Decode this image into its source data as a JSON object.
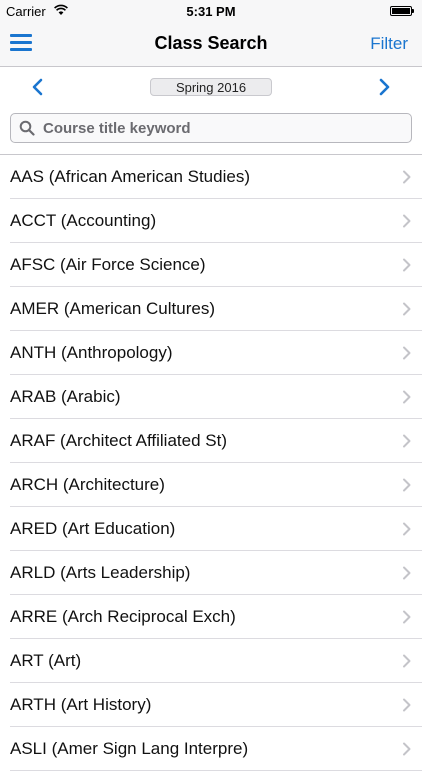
{
  "status_bar": {
    "carrier": "Carrier",
    "time": "5:31 PM",
    "battery_level": 1.0
  },
  "nav": {
    "title": "Class Search",
    "filter_label": "Filter",
    "menu_icon": "hamburger-icon"
  },
  "term": {
    "selected": "Spring 2016",
    "prev_icon": "chevron-left-icon",
    "next_icon": "chevron-right-icon"
  },
  "search": {
    "placeholder": "Course title keyword",
    "value": ""
  },
  "colors": {
    "accent": "#1a75cf",
    "separator": "#dcdbe0",
    "bar_background": "#f7f7f8"
  },
  "departments": [
    "AAS (African American Studies)",
    "ACCT (Accounting)",
    "AFSC (Air Force Science)",
    "AMER (American Cultures)",
    "ANTH (Anthropology)",
    "ARAB (Arabic)",
    "ARAF (Architect Affiliated St)",
    "ARCH (Architecture)",
    "ARED (Art Education)",
    "ARLD (Arts Leadership)",
    "ARRE (Arch Reciprocal Exch)",
    "ART (Art)",
    "ARTH (Art History)",
    "ASLI (Amer Sign Lang Interpre)"
  ]
}
